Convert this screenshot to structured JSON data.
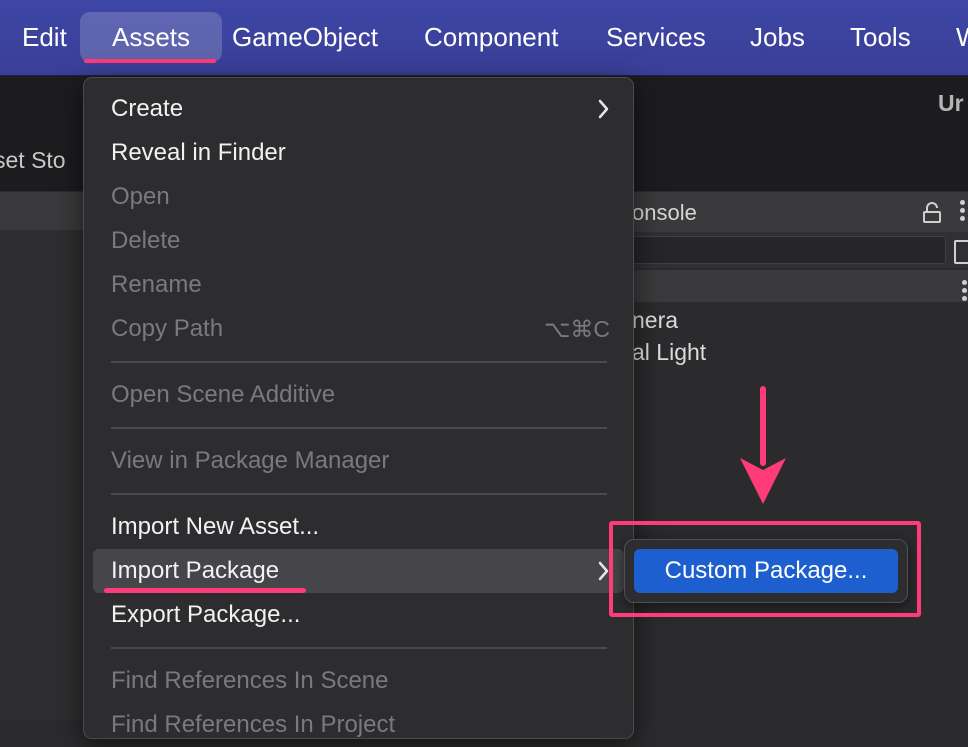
{
  "menubar": {
    "items": [
      {
        "label": "Edit"
      },
      {
        "label": "Assets",
        "active": true
      },
      {
        "label": "GameObject"
      },
      {
        "label": "Component"
      },
      {
        "label": "Services"
      },
      {
        "label": "Jobs"
      },
      {
        "label": "Tools"
      },
      {
        "label": "W"
      }
    ]
  },
  "editor": {
    "window_title": "Ur",
    "asset_store_tab": "set Sto",
    "console_tab": "onsole",
    "hierarchy_items": [
      "nera",
      "al Light"
    ]
  },
  "assets_menu": {
    "items": [
      {
        "label": "Create",
        "enabled": true,
        "submenu": true
      },
      {
        "label": "Reveal in Finder",
        "enabled": true
      },
      {
        "label": "Open",
        "enabled": false
      },
      {
        "label": "Delete",
        "enabled": false
      },
      {
        "label": "Rename",
        "enabled": false
      },
      {
        "label": "Copy Path",
        "enabled": false,
        "shortcut": "⌥⌘C"
      },
      {
        "label": "Open Scene Additive",
        "enabled": false
      },
      {
        "label": "View in Package Manager",
        "enabled": false
      },
      {
        "label": "Import New Asset...",
        "enabled": true
      },
      {
        "label": "Import Package",
        "enabled": true,
        "submenu": true,
        "highlighted": true
      },
      {
        "label": "Export Package...",
        "enabled": true
      },
      {
        "label": "Find References In Scene",
        "enabled": false
      },
      {
        "label": "Find References In Project",
        "enabled": false
      }
    ]
  },
  "import_package_submenu": {
    "items": [
      {
        "label": "Custom Package...",
        "selected": true
      }
    ]
  },
  "colors": {
    "menubar_bg": "#3d46a6",
    "annotation": "#ff3b7a",
    "selection": "#1e5fd0",
    "menu_bg": "#2d2d2f"
  }
}
